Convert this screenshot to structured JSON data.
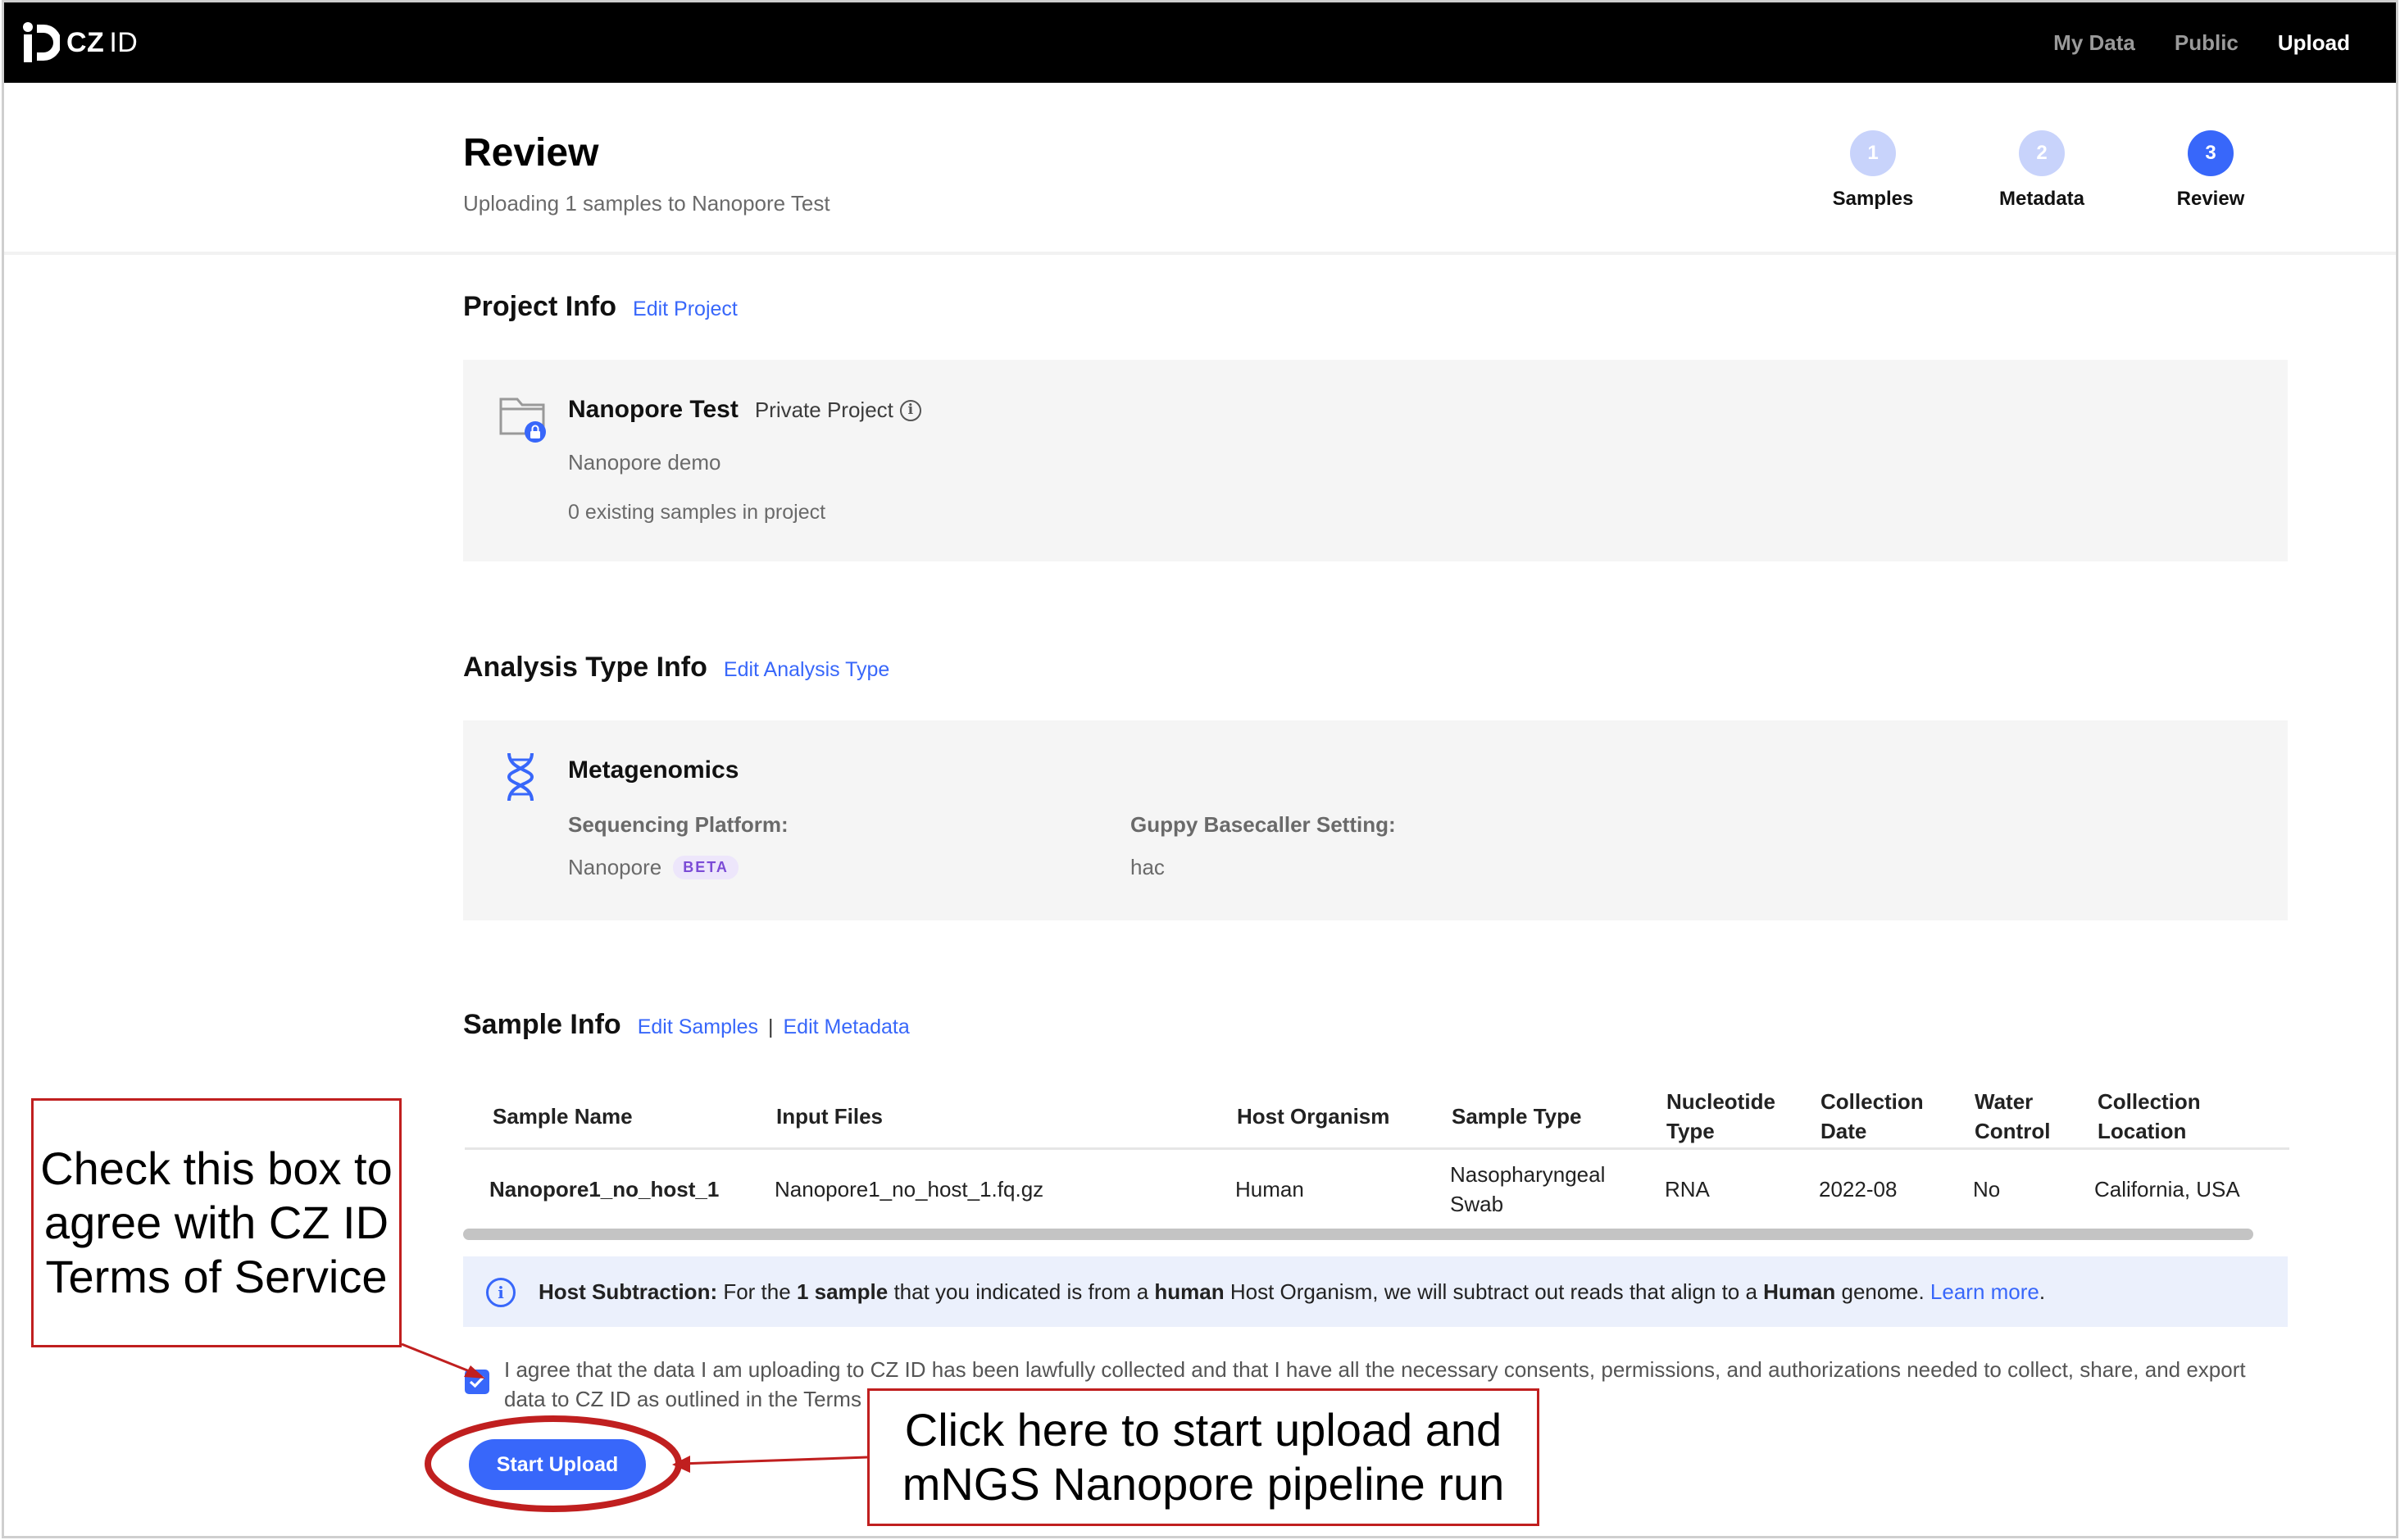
{
  "app": {
    "logo_text": "CZ",
    "logo_text_2": "ID"
  },
  "nav": {
    "my_data": "My Data",
    "public": "Public",
    "upload": "Upload"
  },
  "header": {
    "title": "Review",
    "subtitle": "Uploading 1 samples to Nanopore Test",
    "steps": [
      {
        "number": "1",
        "label": "Samples"
      },
      {
        "number": "2",
        "label": "Metadata"
      },
      {
        "number": "3",
        "label": "Review"
      }
    ]
  },
  "project_info": {
    "title": "Project Info",
    "edit_label": "Edit Project",
    "name": "Nanopore Test",
    "privacy": "Private Project",
    "description": "Nanopore demo",
    "sample_count": "0 existing samples in project"
  },
  "analysis_info": {
    "title": "Analysis Type Info",
    "edit_label": "Edit Analysis Type",
    "type": "Metagenomics",
    "platform_label": "Sequencing Platform:",
    "platform_value": "Nanopore",
    "platform_badge": "BETA",
    "basecaller_label": "Guppy Basecaller Setting:",
    "basecaller_value": "hac"
  },
  "sample_info": {
    "title": "Sample Info",
    "edit_samples_label": "Edit Samples",
    "separator": "|",
    "edit_metadata_label": "Edit Metadata",
    "columns": [
      "Sample Name",
      "Input Files",
      "Host Organism",
      "Sample Type",
      "Nucleotide Type",
      "Collection Date",
      "Water Control",
      "Collection Location"
    ],
    "rows": [
      [
        "Nanopore1_no_host_1",
        "Nanopore1_no_host_1.fq.gz",
        "Human",
        "Nasopharyngeal Swab",
        "RNA",
        "2022-08",
        "No",
        "California, USA"
      ]
    ]
  },
  "host_subtraction": {
    "label": "Host Subtraction:",
    "text_1": " For the ",
    "bold_1": "1 sample",
    "text_2": " that you indicated is from a ",
    "bold_2": "human",
    "text_3": " Host Organism, we will subtract out reads that align to a ",
    "bold_3": "Human",
    "text_4": " genome. ",
    "link": "Learn more",
    "end": "."
  },
  "consent": {
    "checked": true,
    "text": "I agree that the data I am uploading to CZ ID has been lawfully collected and that I have all the necessary consents, permissions, and authorizations needed to collect, share, and export data to CZ ID as outlined in the Terms and Data Privacy Notice."
  },
  "start_upload_label": "Start Upload",
  "annotations": {
    "checkbox_callout": "Check this box to agree with CZ ID Terms of Service",
    "upload_callout": "Click here to start upload and mNGS Nanopore pipeline run",
    "color": "#c01f1f"
  },
  "colors": {
    "accent": "#3867fa",
    "step_inactive": "#c8d3fb",
    "nav_bg": "#000000",
    "card_bg": "#f5f5f5",
    "info_bg": "#ebf0fc"
  }
}
